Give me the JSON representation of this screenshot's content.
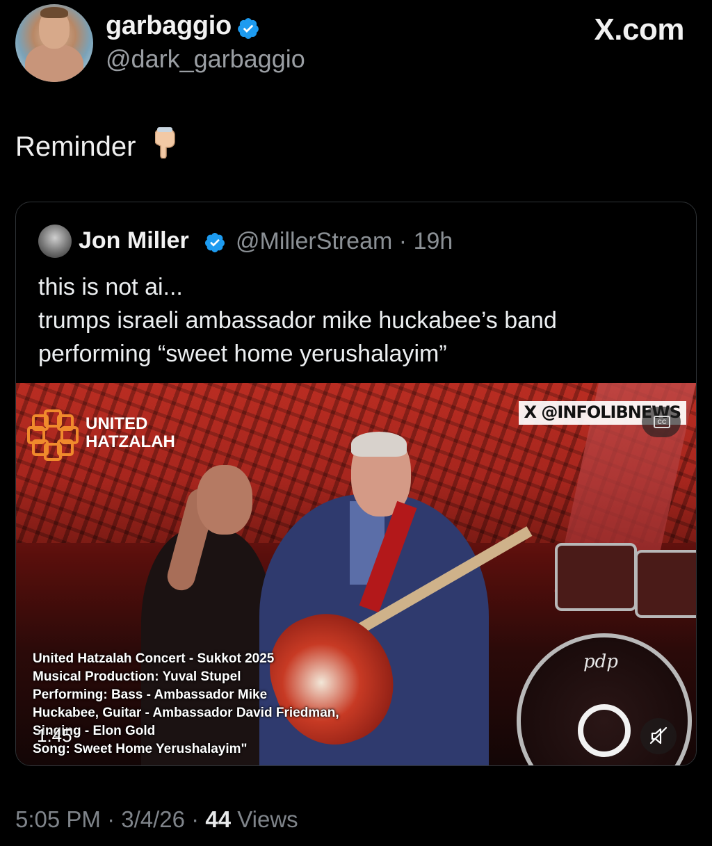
{
  "header": {
    "display_name": "garbaggio",
    "handle": "@dark_garbaggio",
    "brand": "X.com"
  },
  "tweet": {
    "text": "Reminder"
  },
  "quote": {
    "name": "Jon Miller",
    "handle": "@MillerStream",
    "separator": "·",
    "age": "19h",
    "lines": [
      "this is not ai...",
      "trumps israeli ambassador mike huckabee’s band",
      "performing “sweet home yerushalayim”"
    ]
  },
  "video": {
    "logo_line1": "UNITED",
    "logo_line2": "HATZALAH",
    "watermark_x": "X",
    "watermark": "@INFOLIBNEWS",
    "cc_label": "CC",
    "drum_logo": "pdp",
    "caption_lines": [
      "United Hatzalah Concert - Sukkot 2025",
      "Musical Production: Yuval Stupel",
      "Performing: Bass - Ambassador Mike",
      "Huckabee, Guitar - Ambassador David Friedman,",
      "Singing - Elon Gold",
      "Song: Sweet Home Yerushalayim\""
    ],
    "duration": "1:45"
  },
  "footer": {
    "time": "5:05 PM",
    "sep1": "·",
    "date": "3/4/26",
    "sep2": "·",
    "views_count": "44",
    "views_label": "Views"
  },
  "colors": {
    "background": "#000000",
    "verified_blue": "#1d9bf0",
    "muted_text": "#8b9095",
    "logo_orange": "#f08a2c"
  }
}
